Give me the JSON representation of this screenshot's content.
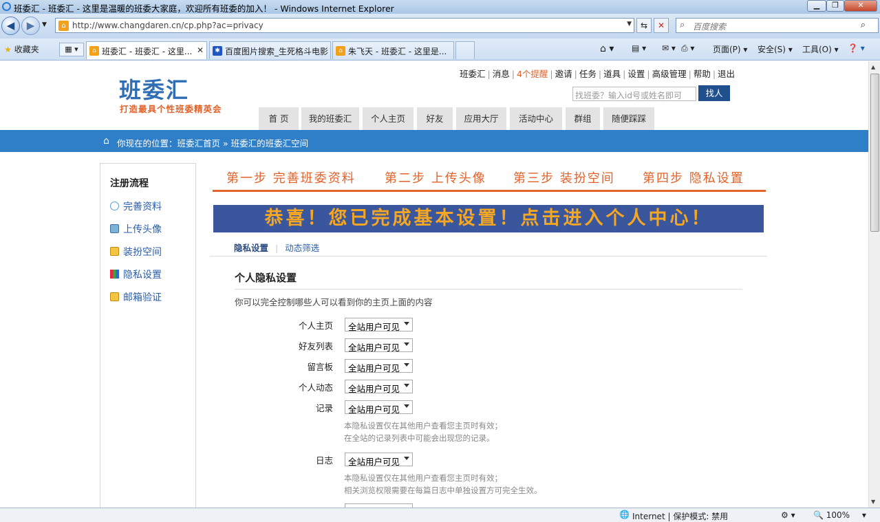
{
  "window": {
    "title": "班委汇 - 班委汇 - 这里是温暖的班委大家庭，欢迎所有班委的加入！ - Windows Internet Explorer"
  },
  "address": {
    "url": "http://www.changdaren.cn/cp.php?ac=privacy",
    "search_placeholder": "百度搜索"
  },
  "toolbar": {
    "favorites": "收藏夹",
    "tabs": [
      {
        "label": "班委汇 - 班委汇 - 这里..."
      },
      {
        "label": "百度图片搜索_生死格斗电影"
      },
      {
        "label": "朱飞天 - 班委汇 - 这里是..."
      }
    ],
    "page": "页面(P)",
    "safety": "安全(S)",
    "tools": "工具(O)"
  },
  "site": {
    "logo": "班委汇",
    "slogan": "打造最具个性班委精英会",
    "top_links": [
      "班委汇",
      "消息",
      "4个提醒",
      "邀请",
      "任务",
      "道具",
      "设置",
      "高级管理",
      "帮助",
      "退出"
    ],
    "finder_placeholder": "找班委？输入id号或姓名即可",
    "find_button": "找人",
    "nav": [
      "首 页",
      "我的班委汇",
      "个人主页",
      "好友",
      "应用大厅",
      "活动中心",
      "群组",
      "随便踩踩"
    ],
    "crumb": "你现在的位置：班委汇首页 » 班委汇的班委汇空间"
  },
  "sidebar": {
    "heading": "注册流程",
    "items": [
      "完善资料",
      "上传头像",
      "装扮空间",
      "隐私设置",
      "邮箱验证"
    ]
  },
  "steps": [
    "第一步 完善班委资料",
    "第二步 上传头像",
    "第三步 装扮空间",
    "第四步 隐私设置"
  ],
  "banner": "恭喜！您已完成基本设置！点击进入个人中心！",
  "subtabs": [
    "隐私设置",
    "动态筛选"
  ],
  "privacy": {
    "title": "个人隐私设置",
    "intro": "你可以完全控制哪些人可以看到你的主页上面的内容",
    "rows": [
      {
        "label": "个人主页",
        "value": "全站用户可见"
      },
      {
        "label": "好友列表",
        "value": "全站用户可见"
      },
      {
        "label": "留言板",
        "value": "全站用户可见"
      },
      {
        "label": "个人动态",
        "value": "全站用户可见"
      },
      {
        "label": "记录",
        "value": "全站用户可见",
        "note1": "本隐私设置仅在其他用户查看您主页时有效；",
        "note2": "在全站的记录列表中可能会出现您的记录。"
      },
      {
        "label": "日志",
        "value": "全站用户可见",
        "note1": "本隐私设置仅在其他用户查看您主页时有效；",
        "note2": "相关浏览权限需要在每篇日志中单独设置方可完全生效。"
      }
    ]
  },
  "status": {
    "zone": "Internet | 保护模式: 禁用",
    "zoom": "100%"
  }
}
